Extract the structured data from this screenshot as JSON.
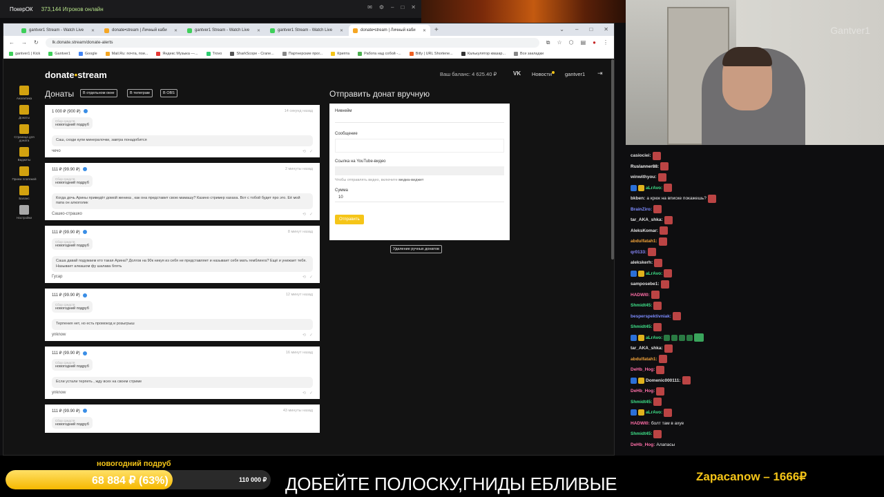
{
  "poker": {
    "app_name": "ПокерОК",
    "online": "373,144 Игроков онлайн"
  },
  "browser": {
    "tabs": [
      {
        "label": "gantver1 Stream - Watch Live",
        "color": "#3ecf5a"
      },
      {
        "label": "donate•stream | Личный каби",
        "color": "#f5a623"
      },
      {
        "label": "gantver1 Stream - Watch Live",
        "color": "#3ecf5a"
      },
      {
        "label": "gantver1 Stream - Watch Live",
        "color": "#3ecf5a"
      },
      {
        "label": "donate•stream | Личный каби",
        "color": "#f5a623"
      }
    ],
    "url": "lk.donate.stream/donate-alerts",
    "bookmarks": [
      "gantver1 | Kick",
      "Gantver1",
      "Google",
      "Mail.Ru: почта, пои...",
      "Яндекс Музыка —...",
      "Trovo",
      "SharkScope - Crane...",
      "Партнерские прог...",
      "Крипта",
      "Работа над собой -...",
      "Bitly | URL Shortene...",
      "Калькулятор квазар...",
      "Все закладки"
    ]
  },
  "site": {
    "brand_a": "donate",
    "brand_dot": "•",
    "brand_b": "stream",
    "balance": "Ваш баланс: 4 625.40 ₽",
    "vk": "VK",
    "news": "Новости",
    "user": "gantver1",
    "nav": [
      "Аналитика",
      "Донаты",
      "Страница для доната",
      "Виджеты",
      "Прием платежей",
      "Баланс",
      "Настройки"
    ],
    "donates_title": "Донаты",
    "chips": [
      "В отдельном окне",
      "В телеграм",
      "В OBS"
    ],
    "donations": [
      {
        "amount": "1 000 ₽ (900 ₽)",
        "time": "14 секунд назад",
        "goal_label": "Сбор средств",
        "goal": "новогодний подруб",
        "message": "Саш, сходи купи минералочки, завтра понадобится",
        "sender": "чечо"
      },
      {
        "amount": "111 ₽ (99.90 ₽)",
        "time": "2 минуты назад",
        "goal_label": "Сбор средств",
        "goal": "новогодний подруб",
        "message": "Когда дочь Арины приведёт домой женика , как она представит свою мамашу? Казино стример хахаха. Вот с тобой будет про это. Её мой папа он алкоголик",
        "sender": "Сашко-страшко"
      },
      {
        "amount": "111 ₽ (99.90 ₽)",
        "time": "8 минут назад",
        "goal_label": "Сбор средств",
        "goal": "новогодний подруб",
        "message": "Саша давай подумаем кто такая Арина? Долгов на 90к никуя из себя не представляет и называет себя мать гемблинга? Ещё и унижает тебя. Называет алкашом фу шалава блять",
        "sender": "Гусар"
      },
      {
        "amount": "111 ₽ (99.90 ₽)",
        "time": "12 минут назад",
        "goal_label": "Сбор средств",
        "goal": "новогодний подруб",
        "message": "Терпения нет, но есть промокод и розыгрыш",
        "sender": "ynknow"
      },
      {
        "amount": "111 ₽ (99.90 ₽)",
        "time": "16 минут назад",
        "goal_label": "Сбор средств",
        "goal": "новогодний подруб",
        "message": "Если устали терпеть , жду всех на своем стриме",
        "sender": "ynknow"
      },
      {
        "amount": "111 ₽ (99.90 ₽)",
        "time": "43 минуты назад",
        "goal_label": "Сбор средств",
        "goal": "новогодний подруб",
        "message": "",
        "sender": ""
      }
    ],
    "manual": {
      "title": "Отправить донат вручную",
      "nick_label": "Никнейм",
      "message_label": "Сообщение",
      "yt_label": "Ссылка на YouTube-видео",
      "yt_hint_a": "Чтобы отправлять видео, включите ",
      "yt_hint_b": "медиа-виджет",
      "sum_label": "Сумма",
      "sum_value": "10",
      "send": "Отправить",
      "delete": "Удаление ручных донатов"
    }
  },
  "cam": {
    "watermark": "Gantver1"
  },
  "chat": [
    {
      "nick": "casiociei:",
      "color": "#e3e3e3",
      "text": "",
      "badges": [],
      "emotes": 1
    },
    {
      "nick": "Ruslanner88:",
      "color": "#f3f3f3",
      "text": "",
      "badges": [],
      "emotes": 1
    },
    {
      "nick": "winwithyou:",
      "color": "#e3e3e3",
      "text": "",
      "badges": [],
      "emotes": 1
    },
    {
      "nick": "aLrAvo:",
      "color": "#3fe38a",
      "text": "",
      "badges": [
        "b",
        "y"
      ],
      "emotes": 1
    },
    {
      "nick": "bkben:",
      "color": "#e3e3e3",
      "text": "а крюк на вписке покажешь?",
      "badges": [],
      "emotes": 1
    },
    {
      "nick": "BrainZiro:",
      "color": "#7d8cff",
      "text": "",
      "badges": [],
      "emotes": 1
    },
    {
      "nick": "tar_AKA_shka:",
      "color": "#e3e3e3",
      "text": "",
      "badges": [],
      "emotes": 1
    },
    {
      "nick": "AleksKomar:",
      "color": "#e3e3e3",
      "text": "",
      "badges": [],
      "emotes": 1
    },
    {
      "nick": "abdulfatah1:",
      "color": "#f2a33a",
      "text": "",
      "badges": [],
      "emotes": 1
    },
    {
      "nick": "qr0133:",
      "color": "#8a8aff",
      "text": "",
      "badges": [],
      "emotes": 1
    },
    {
      "nick": "alekskerh:",
      "color": "#e3e3e3",
      "text": "",
      "badges": [],
      "emotes": 1
    },
    {
      "nick": "aLrAvo:",
      "color": "#3fe38a",
      "text": "",
      "badges": [
        "b",
        "y"
      ],
      "emotes": 1
    },
    {
      "nick": "samposebe1:",
      "color": "#e3e3e3",
      "text": "",
      "badges": [],
      "emotes": 1
    },
    {
      "nick": "HADWI0:",
      "color": "#ff6fa8",
      "text": "",
      "badges": [],
      "emotes": 1
    },
    {
      "nick": "Shmidt45:",
      "color": "#3fe38a",
      "text": "",
      "badges": [],
      "emotes": 1
    },
    {
      "nick": "besperspektivniak:",
      "color": "#7d8cff",
      "text": "",
      "badges": [],
      "emotes": 1
    },
    {
      "nick": "Shmidt45:",
      "color": "#3fe38a",
      "text": "",
      "badges": [],
      "emotes": 1
    },
    {
      "nick": "aLrAvo:",
      "color": "#3fe38a",
      "text": "",
      "badges": [
        "b",
        "y"
      ],
      "emotes": 5
    },
    {
      "nick": "tar_AKA_shka:",
      "color": "#e3e3e3",
      "text": "",
      "badges": [],
      "emotes": 1
    },
    {
      "nick": "abdulfatah1:",
      "color": "#f2a33a",
      "text": "",
      "badges": [],
      "emotes": 1
    },
    {
      "nick": "DeHb_Hog:",
      "color": "#ff6fa8",
      "text": "",
      "badges": [],
      "emotes": 1
    },
    {
      "nick": "Domenic000111:",
      "color": "#e3e3e3",
      "text": "",
      "badges": [
        "b",
        "y"
      ],
      "emotes": 1
    },
    {
      "nick": "DeHb_Hog:",
      "color": "#ff6fa8",
      "text": "",
      "badges": [],
      "emotes": 1
    },
    {
      "nick": "Shmidt45:",
      "color": "#3fe38a",
      "text": "",
      "badges": [],
      "emotes": 1
    },
    {
      "nick": "aLrAvo:",
      "color": "#3fe38a",
      "text": "",
      "badges": [
        "b",
        "y"
      ],
      "emotes": 1
    },
    {
      "nick": "HADWI0:",
      "color": "#ff6fa8",
      "text": "болт там в ахуе",
      "badges": [],
      "emotes": 0
    },
    {
      "nick": "Shmidt45:",
      "color": "#3fe38a",
      "text": "",
      "badges": [],
      "emotes": 1
    },
    {
      "nick": "DeHb_Hog:",
      "color": "#ff6fa8",
      "text": "Алапасы",
      "badges": [],
      "emotes": 0
    }
  ],
  "overlay": {
    "goal_title": "новогодний подруб",
    "goal_progress": 0.63,
    "goal_text": "68 884 ₽ (63%)",
    "goal_target": "110 000 ₽",
    "ticker": "ДОБЕЙТЕ ПОЛОСКУ,ГНИДЫ ЕБЛИВЫЕ",
    "top_donor": "Zapacanow – 1666₽"
  }
}
